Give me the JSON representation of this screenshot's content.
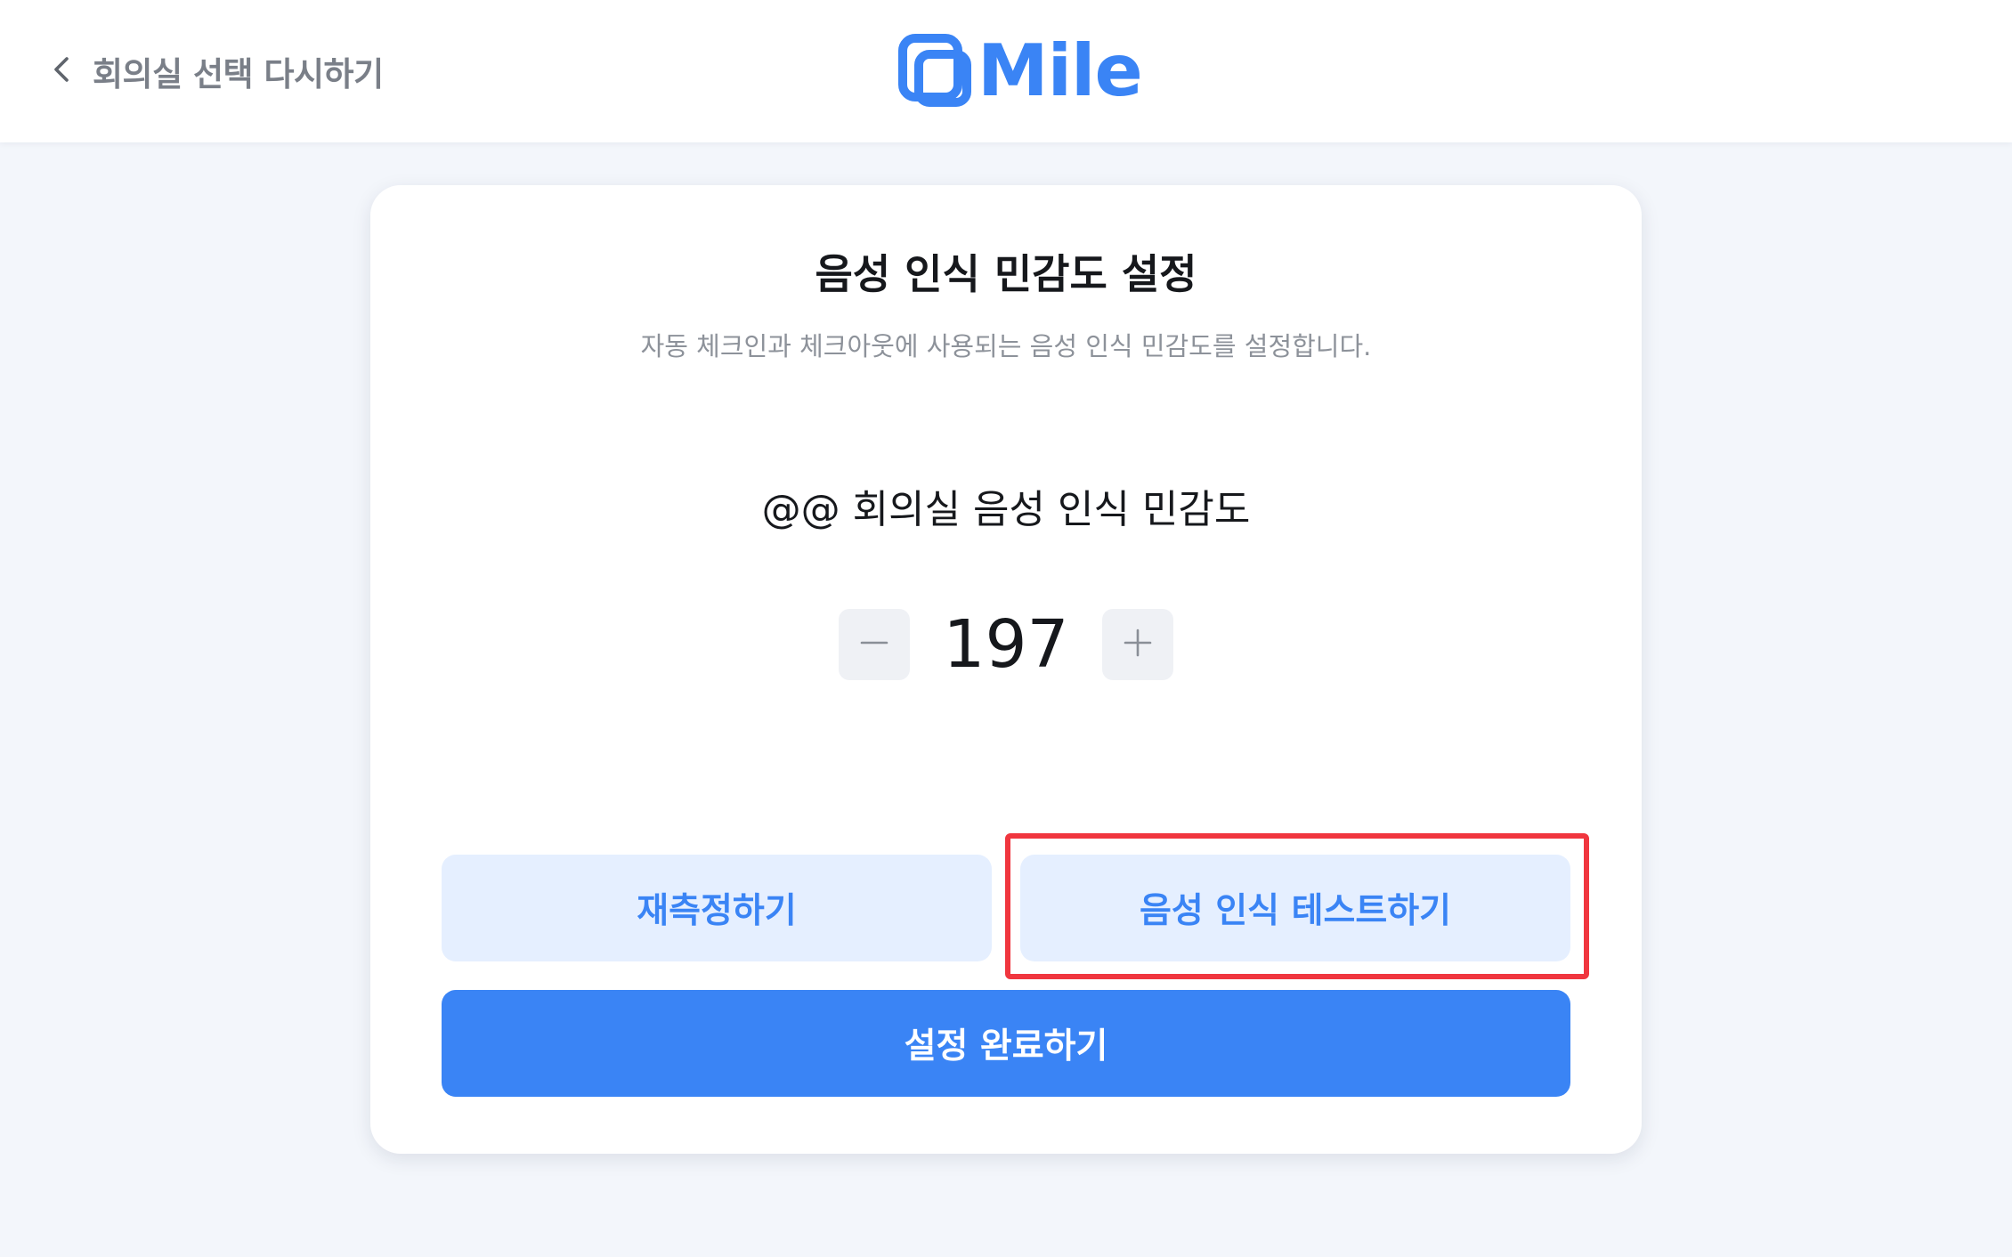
{
  "header": {
    "back_label": "회의실 선택 다시하기",
    "back_icon": "chevron-left-icon",
    "logo_text": "Mile",
    "logo_icon": "mile-logo-icon"
  },
  "card": {
    "title": "음성 인식 민감도 설정",
    "subtitle": "자동 체크인과 체크아웃에 사용되는 음성 인식 민감도를 설정합니다.",
    "room_label": "@@ 회의실 음성 인식 민감도",
    "sensitivity": {
      "value": "197",
      "decrement_icon": "minus-icon",
      "increment_icon": "plus-icon"
    },
    "buttons": {
      "remeasure": "재측정하기",
      "voice_test": "음성 인식 테스트하기",
      "complete": "설정 완료하기"
    }
  },
  "colors": {
    "accent": "#3a84f5",
    "accent_light": "#e5efff",
    "background": "#f3f6fb",
    "highlight": "#f0363f"
  }
}
